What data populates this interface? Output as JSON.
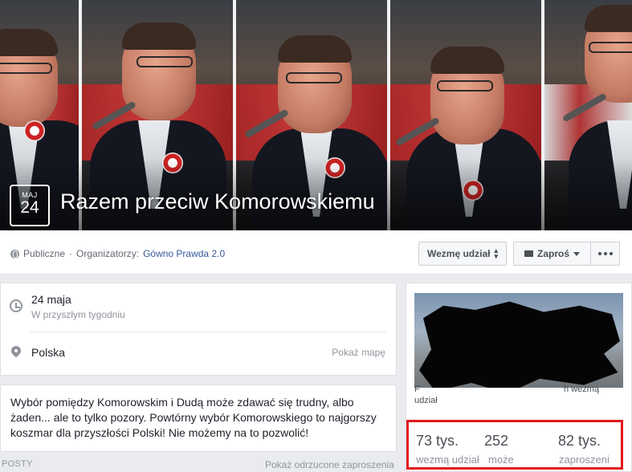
{
  "event": {
    "month": "MAJ",
    "day": "24",
    "title": "Razem przeciw Komorowskiemu"
  },
  "meta": {
    "privacy": "Publiczne",
    "separator": "·",
    "organizers_label": "Organizatorzy:",
    "organizer_name": "Gówno Prawda 2.0"
  },
  "actions": {
    "going_label": "Wezmę udział",
    "invite_label": "Zaproś",
    "more_icon": "ellipsis-icon"
  },
  "details": {
    "date": "24 maja",
    "date_relative": "W przyszłym tygodniu",
    "location": "Polska",
    "map_link": "Pokaż mapę"
  },
  "description": "Wybór pomiędzy Komorowskim i Dudą może zdawać się trudny, albo żaden... ale to tylko pozory. Powtórny wybór Komorowskiego to najgorszy koszmar dla przyszłości Polski! Nie możemy na to pozwolić!",
  "posts": {
    "label": "POSTY",
    "declined_link": "Pokaż odrzucone zaproszenia"
  },
  "sidebar": {
    "caption_left": "F",
    "caption_right": "h wezmą",
    "caption_line2": "udział"
  },
  "stats": {
    "going_count": "73 tys.",
    "going_label": "wezmą udział",
    "maybe_count": "252",
    "maybe_label": "może",
    "invited_count": "82 tys.",
    "invited_label": "zaproszeni"
  },
  "colors": {
    "highlight_box": "#e0191e",
    "link": "#365899",
    "page_bg": "#e9ebee"
  }
}
